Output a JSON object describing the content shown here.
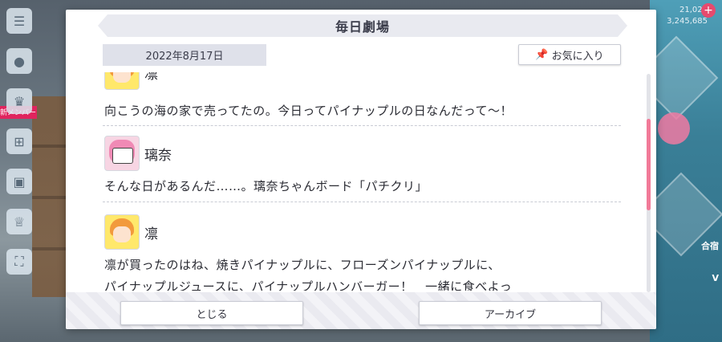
{
  "dialog": {
    "title": "毎日劇場",
    "date": "2022年8月17日",
    "favorite_label": "お気に入り",
    "close_label": "とじる",
    "archive_label": "アーカイブ"
  },
  "entries": [
    {
      "speaker": "凛",
      "lines": [
        "向こうの海の家で売ってたの。今日ってパイナップルの日なんだって〜！"
      ]
    },
    {
      "speaker": "璃奈",
      "lines": [
        "そんな日があるんだ……。璃奈ちゃんボード「パチクリ」"
      ]
    },
    {
      "speaker": "凛",
      "lines": [
        "凛が買ったのはね、焼きパイナップルに、フローズンパイナップルに、",
        "パイナップルジュースに、パイナップルハンバーガー！　一緒に食べよっ"
      ]
    }
  ],
  "background": {
    "top_right_value": "21,022",
    "top_right_value2": "3,245,685",
    "sign_text": "新メンバー",
    "right_tag_1": "合宿",
    "right_tag_2": "V"
  },
  "colors": {
    "accent": "#f17a98",
    "title_bg": "#e9eaf0",
    "date_bg": "#dfe1ea"
  },
  "icons": {
    "favorite": "pin-icon",
    "side": [
      "menu-icon",
      "chat-icon",
      "trophy-icon",
      "gift-icon",
      "screen-icon",
      "cup-icon",
      "expand-icon"
    ]
  }
}
